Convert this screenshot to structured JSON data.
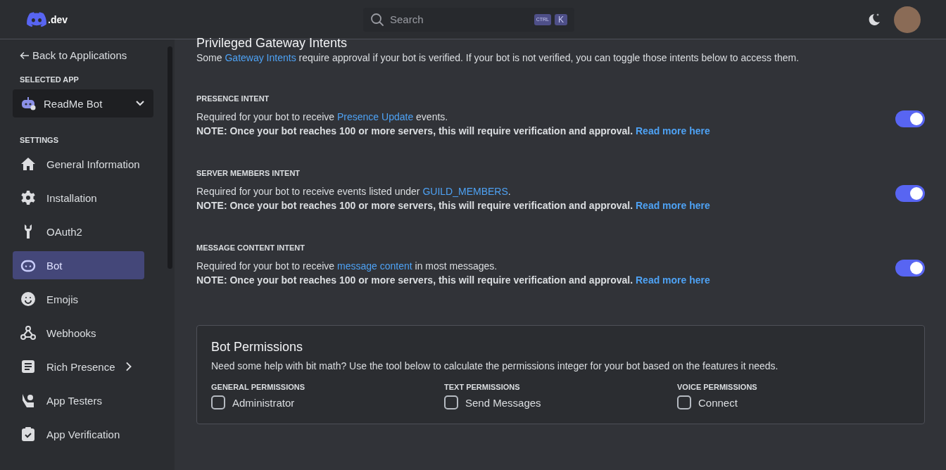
{
  "header": {
    "logo_suffix": ".dev",
    "search": {
      "placeholder": "Search",
      "keys": [
        "CTRL",
        "K"
      ]
    }
  },
  "sidebar": {
    "back_link": "Back to Applications",
    "selected_app_label": "SELECTED APP",
    "app_name": "ReadMe Bot",
    "settings_label": "SETTINGS",
    "items": [
      {
        "label": "General Information",
        "selected": false
      },
      {
        "label": "Installation",
        "selected": false
      },
      {
        "label": "OAuth2",
        "selected": false
      },
      {
        "label": "Bot",
        "selected": true
      },
      {
        "label": "Emojis",
        "selected": false
      },
      {
        "label": "Webhooks",
        "selected": false
      },
      {
        "label": "Rich Presence",
        "selected": false,
        "has_submenu": true
      },
      {
        "label": "App Testers",
        "selected": false
      },
      {
        "label": "App Verification",
        "selected": false
      }
    ]
  },
  "intents_section": {
    "title": "Privileged Gateway Intents",
    "description": {
      "before": "Some ",
      "link": "Gateway Intents",
      "after": " require approval if your bot is verified. If your bot is not verified, you can toggle those intents below to access them."
    },
    "intents": [
      {
        "title": "PRESENCE INTENT",
        "before": "Required for your bot to receive ",
        "link": "Presence Update",
        "after": " events.",
        "note": "NOTE: Once your bot reaches 100 or more servers, this will require verification and approval.",
        "note_link": "Read more here",
        "on": true
      },
      {
        "title": "SERVER MEMBERS INTENT",
        "before": "Required for your bot to receive events listed under ",
        "link": "GUILD_MEMBERS",
        "after": ".",
        "note": "NOTE: Once your bot reaches 100 or more servers, this will require verification and approval.",
        "note_link": "Read more here",
        "on": true
      },
      {
        "title": "MESSAGE CONTENT INTENT",
        "before": "Required for your bot to receive ",
        "link": "message content",
        "after": " in most messages.",
        "note": "NOTE: Once your bot reaches 100 or more servers, this will require verification and approval.",
        "note_link": "Read more here",
        "on": true
      }
    ]
  },
  "permissions": {
    "title": "Bot Permissions",
    "description": "Need some help with bit math? Use the tool below to calculate the permissions integer for your bot based on the features it needs.",
    "columns": [
      {
        "heading": "GENERAL PERMISSIONS",
        "items": [
          {
            "label": "Administrator",
            "checked": false
          }
        ]
      },
      {
        "heading": "TEXT PERMISSIONS",
        "items": [
          {
            "label": "Send Messages",
            "checked": false
          }
        ]
      },
      {
        "heading": "VOICE PERMISSIONS",
        "items": [
          {
            "label": "Connect",
            "checked": false
          }
        ]
      }
    ]
  }
}
